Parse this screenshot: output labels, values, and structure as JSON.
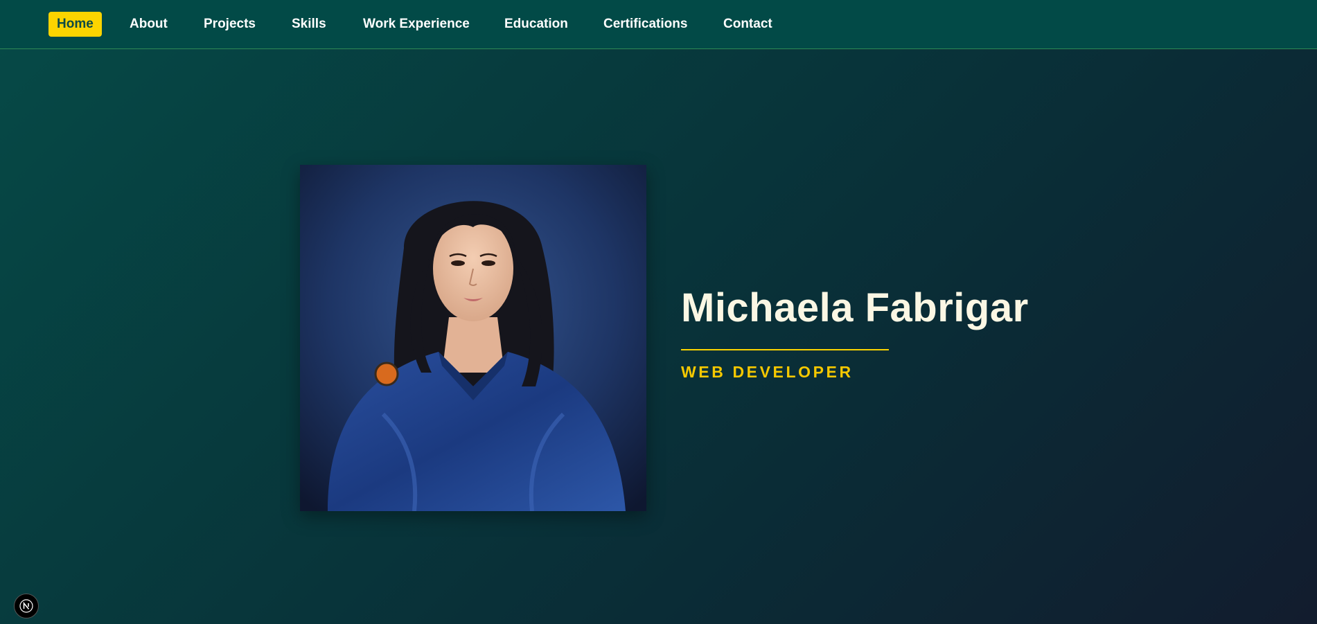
{
  "nav": {
    "items": [
      {
        "label": "Home",
        "active": true
      },
      {
        "label": "About"
      },
      {
        "label": "Projects"
      },
      {
        "label": "Skills"
      },
      {
        "label": "Work Experience"
      },
      {
        "label": "Education"
      },
      {
        "label": "Certifications"
      },
      {
        "label": "Contact"
      }
    ]
  },
  "hero": {
    "name": "Michaela Fabrigar",
    "role": "WEB DEVELOPER",
    "photo_icon": "profile-portrait"
  },
  "dev_badge": {
    "icon": "nextjs-icon",
    "letter": "N"
  },
  "colors": {
    "accent": "#fcd400",
    "nav_bg": "#024a47",
    "name_text": "#fbf7e4"
  }
}
